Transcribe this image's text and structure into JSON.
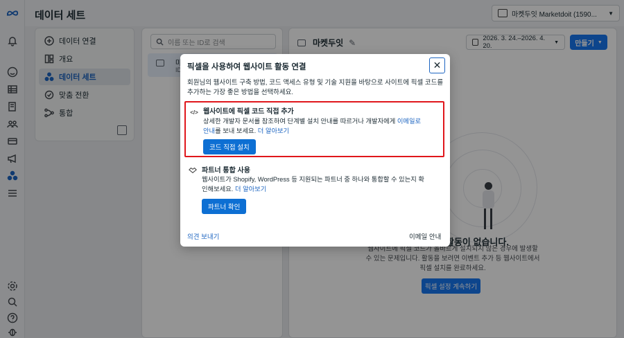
{
  "header": {
    "page_title": "데이터 세트",
    "account_selector": "마켓두잇 Marketdoit (1590..."
  },
  "sidenav": {
    "items": [
      {
        "label": "데이터 연결",
        "icon": "plus-circle-icon"
      },
      {
        "label": "개요",
        "icon": "overview-icon"
      },
      {
        "label": "데이터 세트",
        "icon": "dataset-icon",
        "active": true
      },
      {
        "label": "맞춤 전환",
        "icon": "conversion-icon"
      },
      {
        "label": "통합",
        "icon": "integration-icon"
      }
    ]
  },
  "list": {
    "search_placeholder": "이름 또는 ID로 검색",
    "item_name": "마",
    "item_id": "ID"
  },
  "main": {
    "dataset_name": "마켓두잇",
    "date_range": "2026. 3. 24.–2026. 4. 20.",
    "create_label": "만들기",
    "empty_title": "활동이 없습니다.",
    "empty_desc": "웹사이트에 픽셀 코드가 올바르게 설치되지 않은 경우에 발생할 수 있는 문제입니다. 활동을 보려면 이벤트 추가 등 웹사이트에서 픽셀 설치를 완료하세요.",
    "continue_setup_label": "픽셀 설정 계속하기"
  },
  "modal": {
    "title": "픽셀을 사용하여 웹사이트 활동 연결",
    "close_label": "✕",
    "intro": "회원님의 웹사이트 구축 방법, 코드 액세스 유형 및 기술 지원을 바탕으로 사이트에 픽셀 코드를 추가하는 가장 좋은 방법을 선택하세요.",
    "option_manual": {
      "title": "웹사이트에 픽셀 코드 직접 추가",
      "desc_pre": "상세한 개발자 문서를 참조하여 단계별 설치 안내를 따르거나 개발자에게 ",
      "email_link": "이메일로 안내",
      "desc_mid": "를 보내 보세요. ",
      "more_link": "더 알아보기",
      "button": "코드 직접 설치"
    },
    "option_partner": {
      "title": "파트너 통합 사용",
      "desc_pre": "웹사이트가 Shopify, WordPress 등 지원되는 파트너 중 하나와 통합할 수 있는지 확인해보세요. ",
      "more_link": "더 알아보기",
      "button": "파트너 확인"
    },
    "feedback_link": "의견 보내기",
    "email_guide": "이메일 안내"
  },
  "colors": {
    "accent": "#1877f2",
    "highlight_border": "#e0161b",
    "link": "#1d65c1"
  }
}
